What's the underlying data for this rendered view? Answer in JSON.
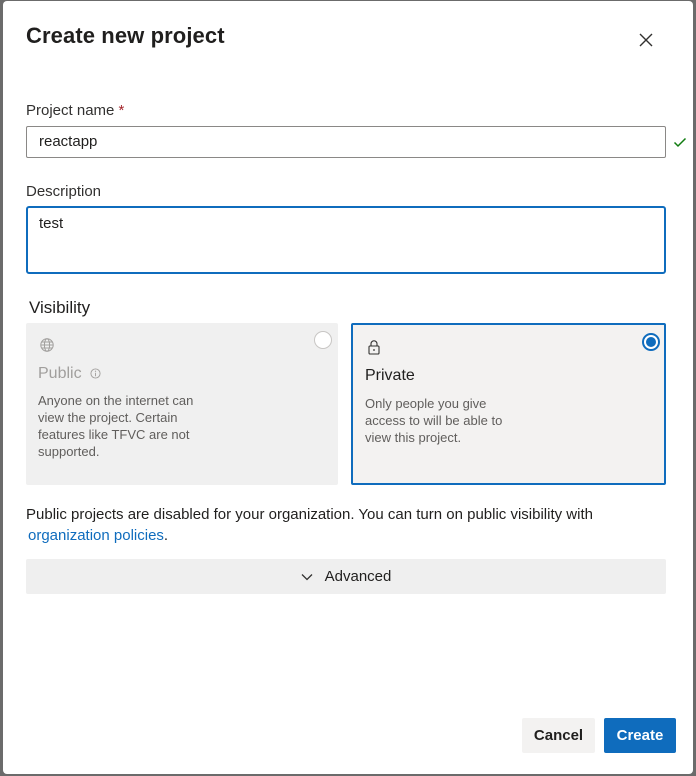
{
  "dialog": {
    "title": "Create new project",
    "close_icon": "close-icon"
  },
  "form": {
    "project_name_label": "Project name",
    "required_marker": "*",
    "project_name_value": "reactapp",
    "valid_icon": "checkmark-icon",
    "description_label": "Description",
    "description_value": "test",
    "visibility_label": "Visibility"
  },
  "visibility": {
    "public": {
      "icon": "globe-icon",
      "title": "Public",
      "info_icon": "info-icon",
      "description": "Anyone on the internet can view the project. Certain features like TFVC are not supported.",
      "selected": false,
      "disabled": true
    },
    "private": {
      "icon": "lock-icon",
      "title": "Private",
      "description": "Only people you give access to will be able to view this project.",
      "selected": true
    }
  },
  "notice": {
    "text": "Public projects are disabled for your organization. You can turn on public visibility with",
    "link_text": "organization policies",
    "trailing": "."
  },
  "advanced": {
    "label": "Advanced",
    "icon": "chevron-down-icon"
  },
  "buttons": {
    "cancel": "Cancel",
    "create": "Create"
  },
  "colors": {
    "accent": "#0f6cbd",
    "success": "#107c10",
    "required": "#a4262c"
  }
}
